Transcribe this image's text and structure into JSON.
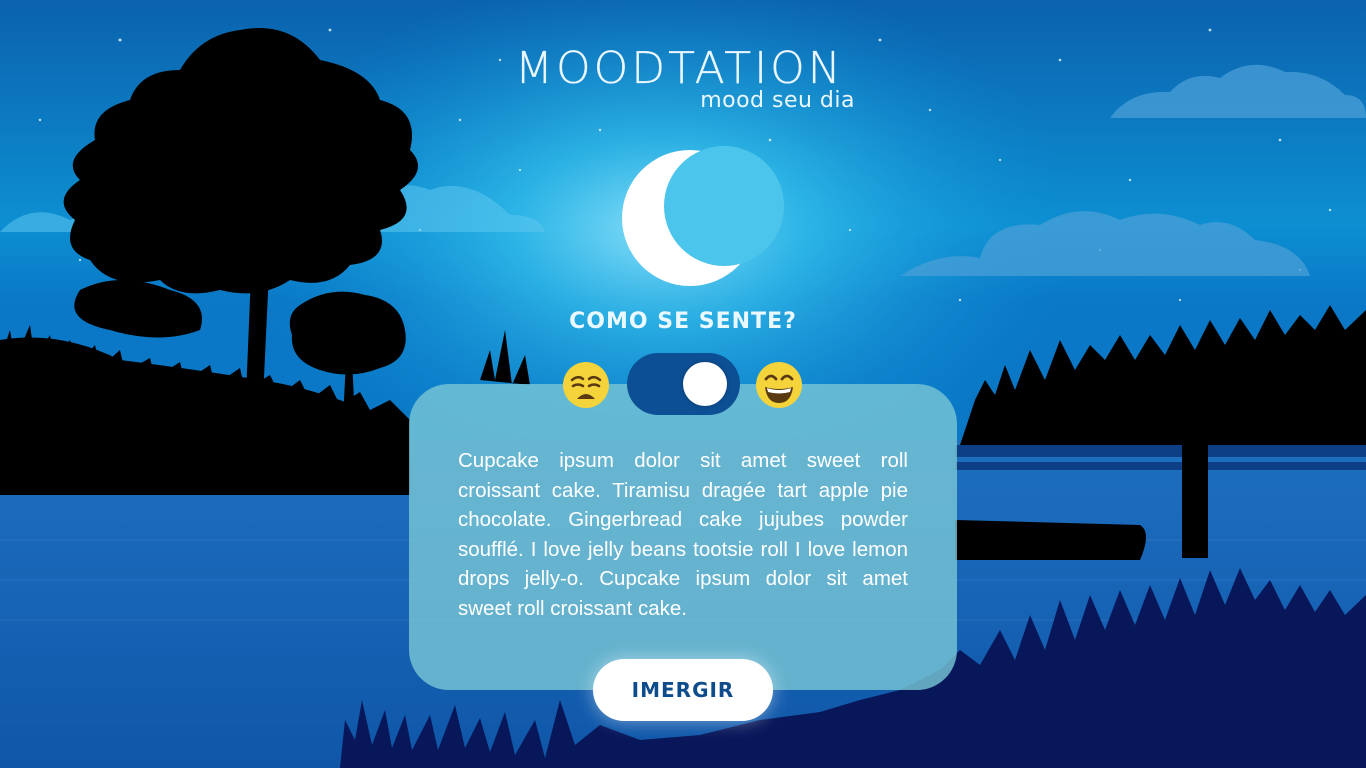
{
  "logo": {
    "title": "MOODTATION",
    "subtitle": "mood seu dia"
  },
  "question": "COMO SE SENTE?",
  "mood_toggle": {
    "left_icon": "weary-face-icon",
    "right_icon": "grinning-face-icon",
    "state": "right"
  },
  "card": {
    "text": "Cupcake ipsum dolor sit amet sweet roll croissant cake. Tiramisu dragée tart apple pie chocolate. Gingerbread cake jujubes powder soufflé. I love jelly beans tootsie roll I love lemon drops jelly-o. Cupcake ipsum dolor sit amet sweet roll croissant cake."
  },
  "cta": {
    "label": "IMERGIR"
  },
  "colors": {
    "sky_top": "#0b5ea8",
    "sky_glow": "#16bfe8",
    "water": "#1a63b8",
    "ground": "#08175a",
    "toggle": "#0d4f94",
    "card": "#76c4d4",
    "cta_text": "#0f4c8c",
    "emoji": "#f5d33a"
  }
}
